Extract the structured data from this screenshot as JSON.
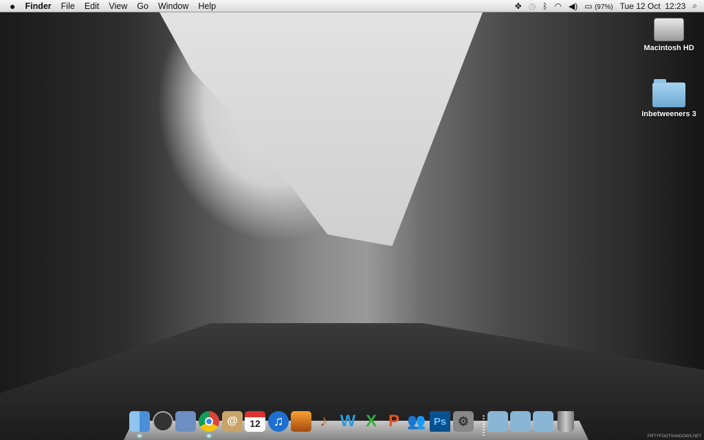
{
  "menubar": {
    "apple": "",
    "app": "Finder",
    "items": [
      "File",
      "Edit",
      "View",
      "Go",
      "Window",
      "Help"
    ],
    "status": {
      "battery": "(97%)",
      "datetime": "Tue 12 Oct  12:23"
    }
  },
  "desktop": [
    {
      "label": "Macintosh HD",
      "icon": "hard-drive-icon"
    },
    {
      "label": "Inbetweeners 3",
      "icon": "folder-icon"
    }
  ],
  "dock": {
    "apps": [
      {
        "name": "Finder",
        "running": true
      },
      {
        "name": "Dashboard"
      },
      {
        "name": "Mail"
      },
      {
        "name": "Google Chrome",
        "running": true
      },
      {
        "name": "Address Book",
        "glyph": "@"
      },
      {
        "name": "iCal",
        "glyph": "12"
      },
      {
        "name": "iTunes",
        "glyph": "♫"
      },
      {
        "name": "iPhoto"
      },
      {
        "name": "GarageBand"
      },
      {
        "name": "Word",
        "glyph": "W"
      },
      {
        "name": "Excel",
        "glyph": "X"
      },
      {
        "name": "PowerPoint",
        "glyph": "P"
      },
      {
        "name": "Messenger"
      },
      {
        "name": "Photoshop",
        "glyph": "Ps"
      },
      {
        "name": "System Preferences"
      }
    ],
    "stacks": [
      {
        "name": "Applications"
      },
      {
        "name": "Documents"
      },
      {
        "name": "Downloads"
      },
      {
        "name": "Trash"
      }
    ]
  },
  "wallpaper_credit": "FIFTYFOOTSHADOWS.NET"
}
